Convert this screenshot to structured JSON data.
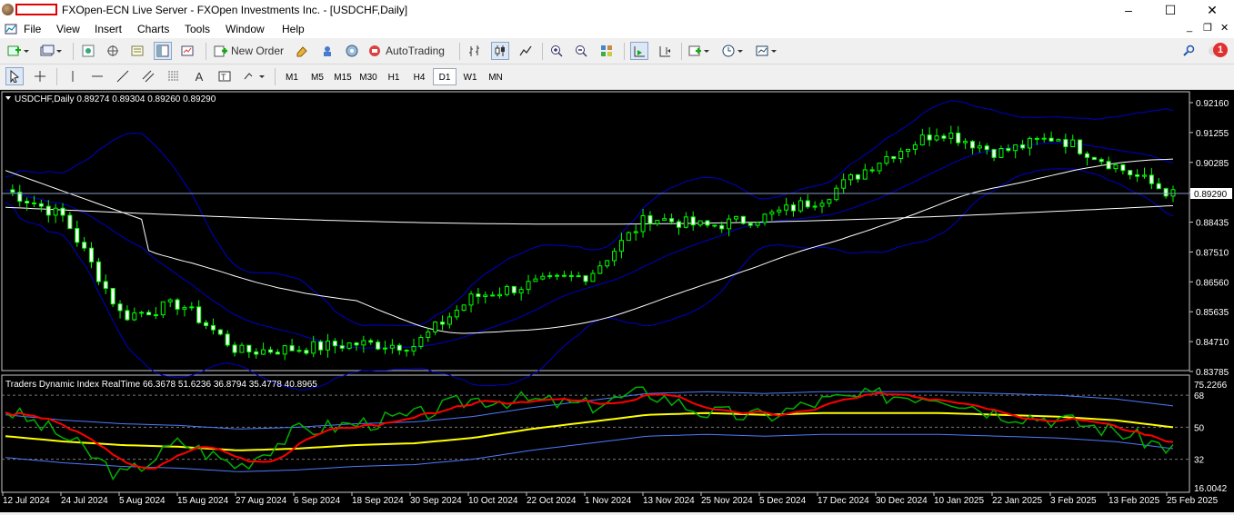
{
  "window": {
    "title": "FXOpen-ECN Live Server - FXOpen Investments Inc. - [USDCHF,Daily]",
    "minimize": "–",
    "maximize": "☐",
    "close": "✕"
  },
  "menu": [
    "File",
    "View",
    "Insert",
    "Charts",
    "Tools",
    "Window",
    "Help"
  ],
  "toolbar": {
    "new_order": "New Order",
    "autotrading": "AutoTrading",
    "notifications_count": "1"
  },
  "timeframes": [
    "M1",
    "M5",
    "M15",
    "M30",
    "H1",
    "H4",
    "D1",
    "W1",
    "MN"
  ],
  "active_timeframe": "D1",
  "main_chart": {
    "header": "USDCHF,Daily  0.89274 0.89304 0.89260 0.89290",
    "current_price_label": "0.89290",
    "price_ticks": [
      "0.92160",
      "0.91255",
      "0.90285",
      "0.89290",
      "0.88435",
      "0.87510",
      "0.86560",
      "0.85635",
      "0.84710",
      "0.83785"
    ]
  },
  "indicator": {
    "header": "Traders Dynamic Index RealTime 66.3678 51.6236 36.8794 35.4778 40.8965",
    "ticks": [
      "75.2266",
      "68",
      "50",
      "32",
      "16.0042"
    ]
  },
  "date_axis": [
    "12 Jul 2024",
    "24 Jul 2024",
    "5 Aug 2024",
    "15 Aug 2024",
    "27 Aug 2024",
    "6 Sep 2024",
    "18 Sep 2024",
    "30 Sep 2024",
    "10 Oct 2024",
    "22 Oct 2024",
    "1 Nov 2024",
    "13 Nov 2024",
    "25 Nov 2024",
    "5 Dec 2024",
    "17 Dec 2024",
    "30 Dec 2024",
    "10 Jan 2025",
    "22 Jan 2025",
    "3 Feb 2025",
    "13 Feb 2025",
    "25 Feb 2025"
  ],
  "chart_data": [
    {
      "type": "line",
      "x": [
        "2024-07-12",
        "2024-07-24",
        "2024-08-05",
        "2024-08-15",
        "2024-08-27",
        "2024-09-06",
        "2024-09-18",
        "2024-09-30",
        "2024-10-10",
        "2024-10-22",
        "2024-11-01",
        "2024-11-13",
        "2024-11-25",
        "2024-12-05",
        "2024-12-17",
        "2024-12-30",
        "2025-01-10",
        "2025-01-22",
        "2025-02-03",
        "2025-02-13",
        "2025-02-25"
      ],
      "series": [
        {
          "name": "Close",
          "values": [
            0.8945,
            0.886,
            0.855,
            0.859,
            0.844,
            0.845,
            0.8465,
            0.846,
            0.861,
            0.865,
            0.868,
            0.886,
            0.883,
            0.886,
            0.892,
            0.904,
            0.913,
            0.906,
            0.911,
            0.902,
            0.8929
          ]
        }
      ],
      "ylim": [
        0.83785,
        0.9216
      ],
      "color": "#00ff00"
    },
    {
      "type": "line",
      "x": [
        "2024-07-12",
        "2024-07-24",
        "2024-08-05",
        "2024-08-15",
        "2024-08-27",
        "2024-09-06",
        "2024-09-18",
        "2024-09-30",
        "2024-10-10",
        "2024-10-22",
        "2024-11-01",
        "2024-11-13",
        "2024-11-25",
        "2024-12-05",
        "2024-12-17",
        "2024-12-30",
        "2025-01-10",
        "2025-01-22",
        "2025-02-03",
        "2025-02-13",
        "2025-02-25"
      ],
      "series": [
        {
          "values": [
            60,
            45,
            22,
            42,
            28,
            48,
            52,
            56,
            66,
            65,
            62,
            70,
            58,
            56,
            65,
            68,
            68,
            58,
            55,
            48,
            38
          ]
        },
        {
          "values": [
            48,
            44,
            38,
            36,
            32,
            35,
            40,
            45,
            54,
            60,
            62,
            68,
            64,
            56,
            62,
            65,
            65,
            58,
            52,
            50,
            42
          ]
        },
        {
          "values": [
            45,
            42,
            40,
            39,
            37,
            38,
            40,
            41,
            44,
            49,
            53,
            57,
            58,
            57,
            58,
            58,
            58,
            57,
            56,
            54,
            50
          ]
        }
      ],
      "ylim": [
        16.0042,
        75.2266
      ]
    }
  ],
  "colors": {
    "candle_up": "#00ff00",
    "candle_down_fill": "#ffffff",
    "bands": "#0000cc",
    "ma": "#ffffff",
    "tdi_price": "#00b000",
    "tdi_signal": "#ff0000",
    "tdi_mbl": "#ffff00",
    "tdi_bands": "#4d7bff"
  }
}
